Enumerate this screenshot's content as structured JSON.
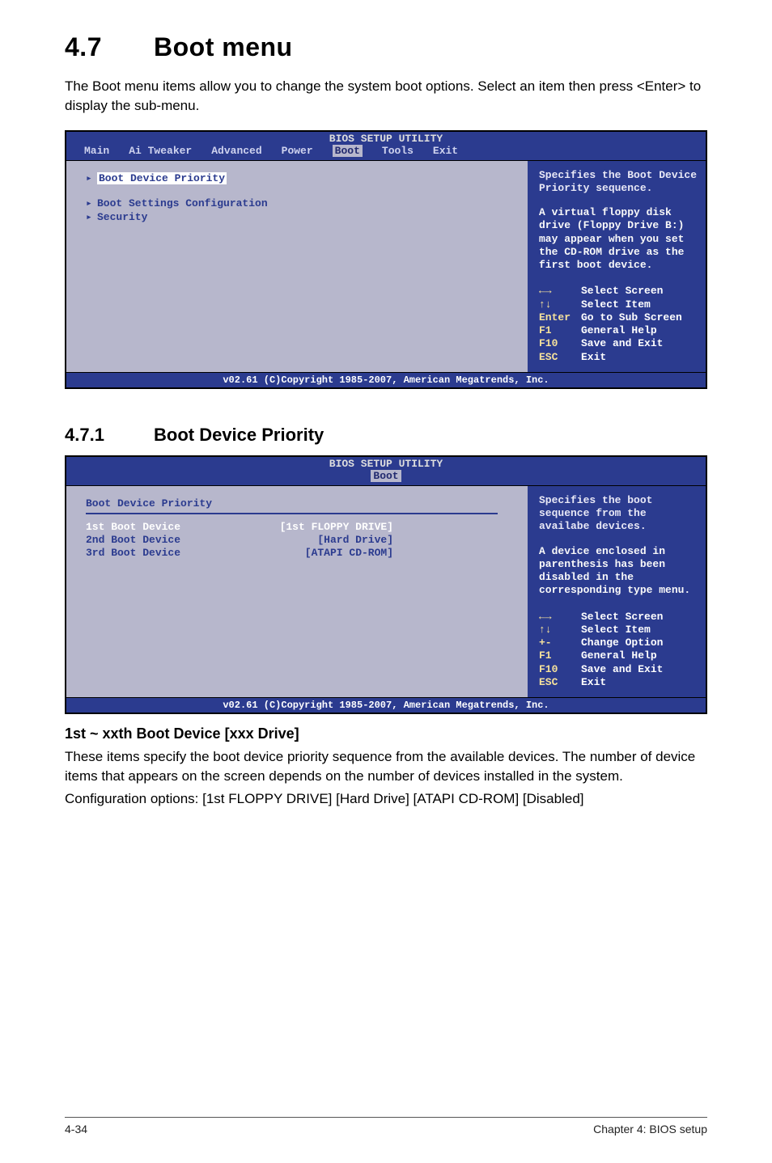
{
  "section": {
    "num": "4.7",
    "title": "Boot menu"
  },
  "intro": "The Boot menu items allow you to change the system boot options. Select an item then press <Enter> to display the sub-menu.",
  "bios1": {
    "title": "BIOS SETUP UTILITY",
    "tabs": [
      "Main",
      "Ai Tweaker",
      "Advanced",
      "Power",
      "Boot",
      "Tools",
      "Exit"
    ],
    "active_tab": "Boot",
    "items": [
      {
        "label": "Boot Device Priority",
        "selected": true
      },
      {
        "label": "Boot Settings Configuration",
        "selected": false
      },
      {
        "label": "Security",
        "selected": false
      }
    ],
    "help_top": "Specifies the Boot Device Priority sequence.",
    "help_mid": "A virtual floppy disk drive (Floppy Drive B:) may appear when you set the CD-ROM drive as the first boot device.",
    "nav": [
      {
        "k": "←→",
        "v": "Select Screen",
        "arrow": true
      },
      {
        "k": "↑↓",
        "v": "Select Item",
        "arrow": true
      },
      {
        "k": "Enter",
        "v": "Go to Sub Screen"
      },
      {
        "k": "F1",
        "v": "General Help"
      },
      {
        "k": "F10",
        "v": "Save and Exit"
      },
      {
        "k": "ESC",
        "v": "Exit"
      }
    ],
    "footer": "v02.61 (C)Copyright 1985-2007, American Megatrends, Inc."
  },
  "subsection": {
    "num": "4.7.1",
    "title": "Boot Device Priority"
  },
  "bios2": {
    "title": "BIOS SETUP UTILITY",
    "active_tab": "Boot",
    "heading": "Boot Device Priority",
    "devices": [
      {
        "label": "1st Boot Device",
        "value": "[1st FLOPPY DRIVE]",
        "white": true
      },
      {
        "label": "2nd Boot Device",
        "value": "[Hard Drive]",
        "white": false
      },
      {
        "label": "3rd Boot Device",
        "value": "[ATAPI CD-ROM]",
        "white": false
      }
    ],
    "help_top": "Specifies the boot sequence from the availabe devices.",
    "help_mid": "A device enclosed in parenthesis has been disabled in the corresponding type menu.",
    "nav": [
      {
        "k": "←→",
        "v": "Select Screen",
        "arrow": true
      },
      {
        "k": "↑↓",
        "v": "Select Item",
        "arrow": true
      },
      {
        "k": "+-",
        "v": "Change Option"
      },
      {
        "k": "F1",
        "v": "General Help"
      },
      {
        "k": "F10",
        "v": "Save and Exit"
      },
      {
        "k": "ESC",
        "v": "Exit"
      }
    ],
    "footer": "v02.61 (C)Copyright 1985-2007, American Megatrends, Inc."
  },
  "item_section": {
    "title": "1st ~ xxth Boot Device [xxx Drive]",
    "p1": "These items specify the boot device priority sequence from the available devices. The number of device items that appears on the screen depends on the number of devices installed in the system.",
    "p2": "Configuration options: [1st FLOPPY DRIVE] [Hard Drive] [ATAPI CD-ROM] [Disabled]"
  },
  "footer": {
    "left": "4-34",
    "right": "Chapter 4: BIOS setup"
  }
}
